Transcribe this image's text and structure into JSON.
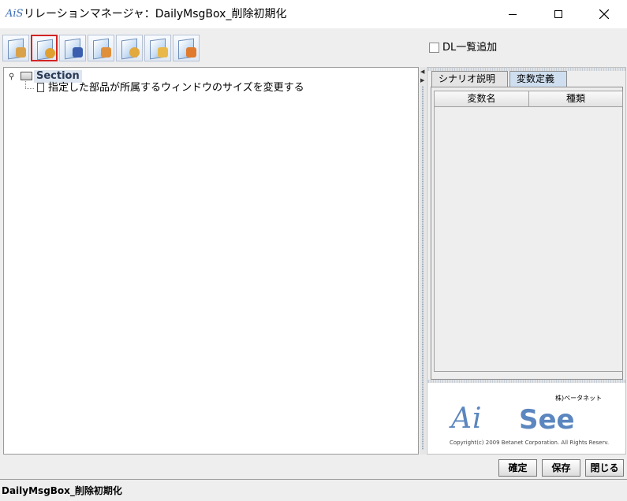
{
  "window": {
    "title": "リレーションマネージャ：DailyMsgBox_削除初期化",
    "app_icon_text": "AiS",
    "controls": [
      "minimize-icon",
      "maximize-icon",
      "close-icon"
    ]
  },
  "toolbar": {
    "buttons": [
      {
        "icon": "edit-document-icon",
        "active": false
      },
      {
        "icon": "settings-document-icon",
        "active": true
      },
      {
        "icon": "pen-document-icon",
        "active": false
      },
      {
        "icon": "cut-document-icon",
        "active": false
      },
      {
        "icon": "refresh-document-icon",
        "active": false
      },
      {
        "icon": "copy-document-icon",
        "active": false
      },
      {
        "icon": "paste-document-icon",
        "active": false
      }
    ],
    "dl_add_label": "DL一覧追加",
    "dl_add_checked": false
  },
  "tree": {
    "root_label": "Section",
    "child_label": "指定した部品が所属するウィンドウのサイズを変更する"
  },
  "right_panel": {
    "tabs": [
      {
        "label": "シナリオ説明",
        "selected": false
      },
      {
        "label": "変数定義",
        "selected": true
      }
    ],
    "table": {
      "columns": [
        "変数名",
        "種類"
      ],
      "rows": []
    },
    "logo": {
      "company": "株)ベータネット",
      "mark": "Ai",
      "name": "See",
      "copyright": "Copyright(c) 2009 Betanet Corporation. All Rights Reserv."
    }
  },
  "buttons": {
    "confirm": "確定",
    "save": "保存",
    "close": "閉じる"
  },
  "status": {
    "text": "DailyMsgBox_削除初期化"
  },
  "colors": {
    "selection": "#dde5f0",
    "accent": "#5b86bf",
    "active_tool_border": "#d22323"
  }
}
